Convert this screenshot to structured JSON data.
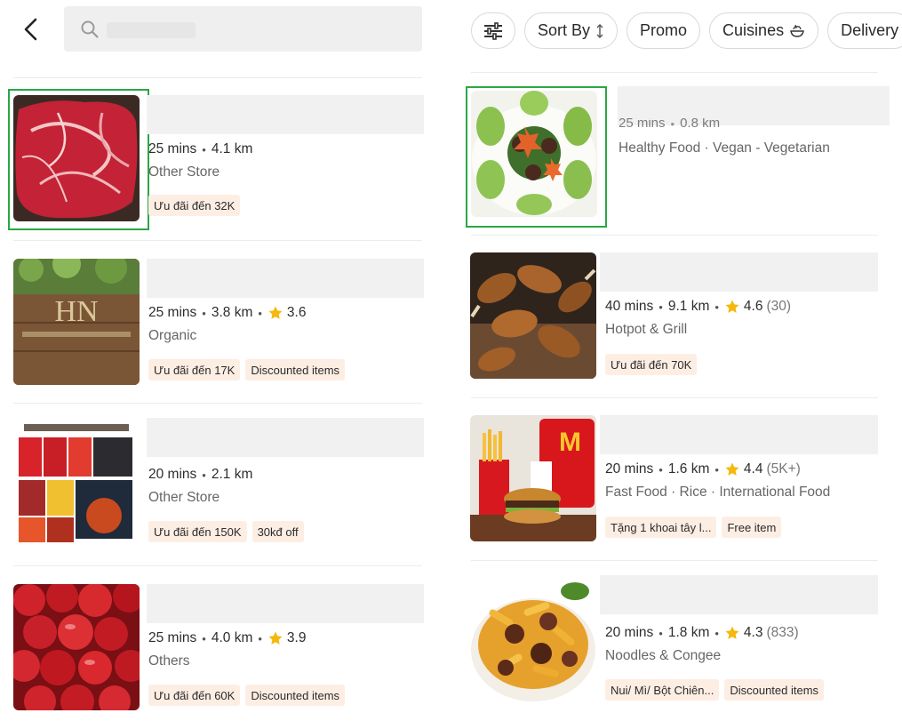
{
  "search": {
    "value": "",
    "placeholder": ""
  },
  "filters": {
    "sort_label": "Sort By",
    "promo_label": "Promo",
    "cuisines_label": "Cuisines",
    "delivery_label": "Delivery"
  },
  "left_stores": [
    {
      "time": "25 mins",
      "distance": "4.1 km",
      "rating": "",
      "rating_count": "",
      "cuisine": "Other Store",
      "tags": [
        "Ưu đãi đến 32K"
      ],
      "image": "raw-beef"
    },
    {
      "time": "25 mins",
      "distance": "3.8 km",
      "rating": "3.6",
      "rating_count": "",
      "cuisine": "Organic",
      "tags": [
        "Ưu đãi đến 17K",
        "Discounted items"
      ],
      "image": "organic-wood-sign"
    },
    {
      "time": "20 mins",
      "distance": "2.1 km",
      "rating": "",
      "rating_count": "",
      "cuisine": "Other Store",
      "tags": [
        "Ưu đãi đến 150K",
        "30kđ off"
      ],
      "image": "hotpot-packages"
    },
    {
      "time": "25 mins",
      "distance": "4.0 km",
      "rating": "3.9",
      "rating_count": "",
      "cuisine": "Others",
      "tags": [
        "Ưu đãi đến 60K",
        "Discounted items"
      ],
      "image": "red-apples"
    }
  ],
  "right_stores": [
    {
      "time": "25 mins",
      "distance": "0.8 km",
      "rating": "",
      "rating_count": "",
      "cuisine": "Healthy Food · Vegan - Vegetarian",
      "tags": [],
      "image": "vegetarian-dish"
    },
    {
      "time": "40 mins",
      "distance": "9.1 km",
      "rating": "4.6",
      "rating_count": "(30)",
      "cuisine": "Hotpot & Grill",
      "tags": [
        "Ưu đãi đến 70K"
      ],
      "image": "grilled-drumsticks"
    },
    {
      "time": "20 mins",
      "distance": "1.6 km",
      "rating": "4.4",
      "rating_count": "(5K+)",
      "cuisine": "Fast Food · Rice · International Food",
      "tags": [
        "Tặng 1 khoai tây l...",
        "Free item"
      ],
      "image": "mcdonalds-meal"
    },
    {
      "time": "20 mins",
      "distance": "1.8 km",
      "rating": "4.3",
      "rating_count": "(833)",
      "cuisine": "Noodles & Congee",
      "tags": [
        "Nui/ Mì/ Bột Chiên...",
        "Discounted items"
      ],
      "image": "beef-pasta"
    }
  ],
  "colors": {
    "accent": "#2aa745",
    "tag_bg": "#fdeee4",
    "star": "#f5b80b",
    "placeholder_bar": "#f1f1f1",
    "chip_border": "#d9d9d9"
  },
  "icons": {
    "back": "chevron-left-icon",
    "search": "search-icon",
    "filter": "sliders-icon",
    "sort": "sort-arrows-icon",
    "cuisines": "food-bowl-icon",
    "rating": "star-icon"
  }
}
